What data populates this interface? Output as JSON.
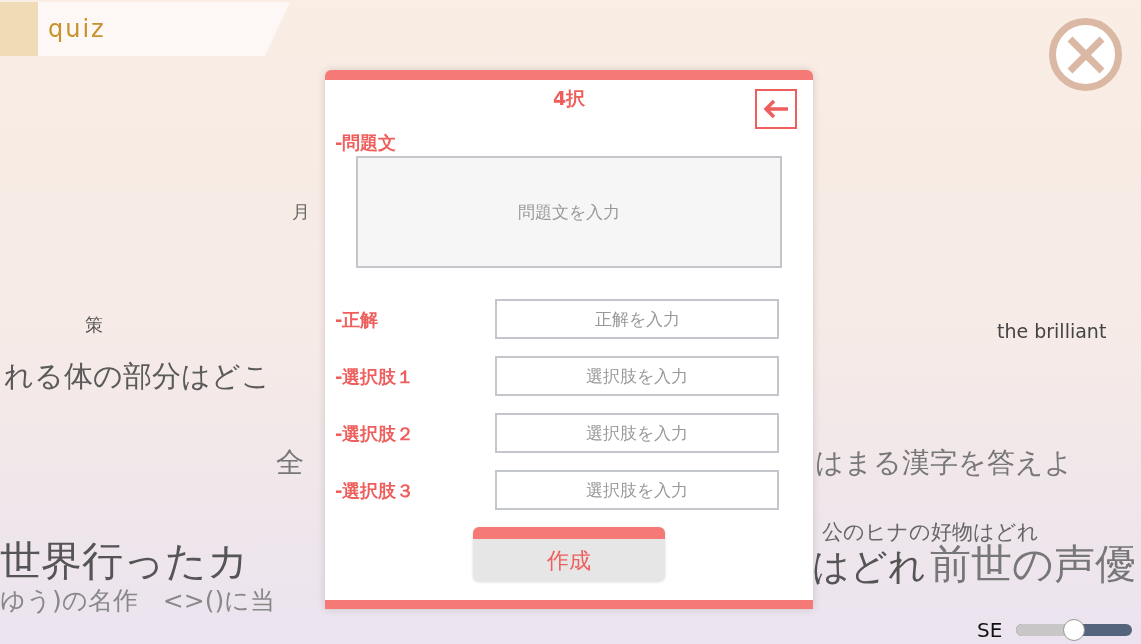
{
  "header_tab": {
    "label": "quiz"
  },
  "background_texts": [
    {
      "text": "月"
    },
    {
      "text": "策"
    },
    {
      "text": "れる体の部分はどこ"
    },
    {
      "text": "the brilliant"
    },
    {
      "text": "全"
    },
    {
      "text": "はまる漢字を答えよ"
    },
    {
      "text": "公のヒナの好物はどれ"
    },
    {
      "text": "世界行ったカ"
    },
    {
      "text": "ゆう)の名作　<>()に当"
    },
    {
      "text": "はどれ"
    },
    {
      "text": "前世の声優"
    }
  ],
  "dialog": {
    "title": "4択",
    "question": {
      "label": "-問題文",
      "placeholder": "問題文を入力"
    },
    "fields": [
      {
        "label": "-正解",
        "placeholder": "正解を入力"
      },
      {
        "label": "-選択肢１",
        "placeholder": "選択肢を入力"
      },
      {
        "label": "-選択肢２",
        "placeholder": "選択肢を入力"
      },
      {
        "label": "-選択肢３",
        "placeholder": "選択肢を入力"
      }
    ],
    "submit": "作成"
  },
  "se_slider": {
    "label": "SE",
    "level": 0.5
  }
}
